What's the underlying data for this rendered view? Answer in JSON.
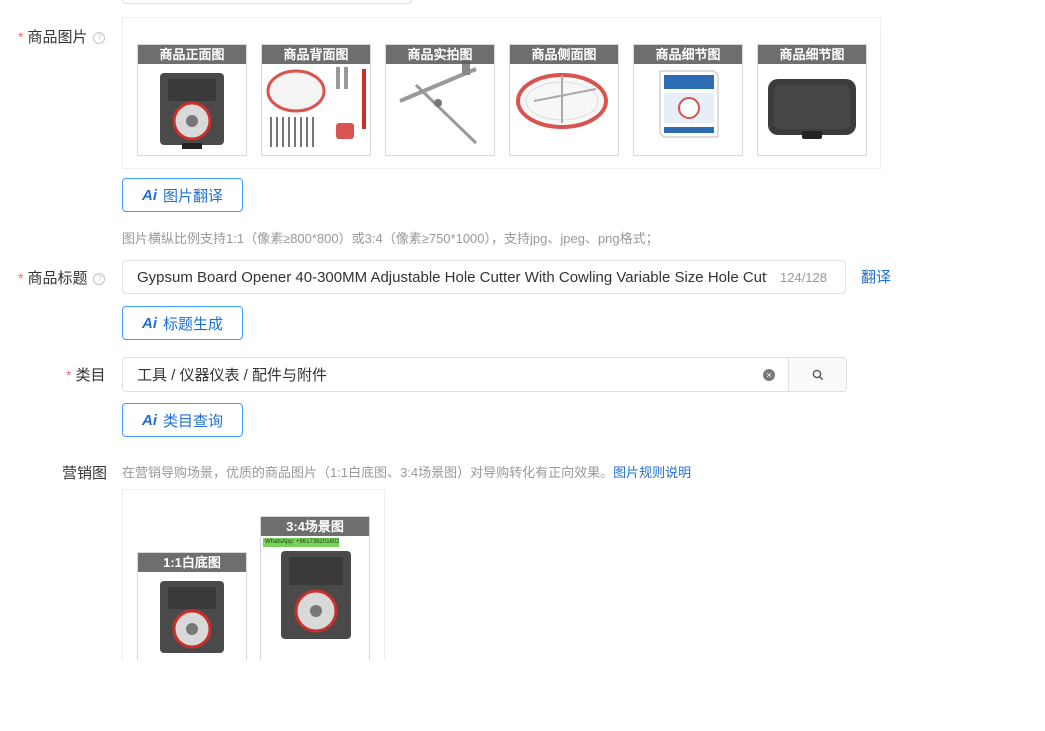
{
  "product_images": {
    "label": "商品图片",
    "help": "?",
    "thumbs": [
      {
        "caption": "商品正面图"
      },
      {
        "caption": "商品背面图"
      },
      {
        "caption": "商品实拍图"
      },
      {
        "caption": "商品侧面图"
      },
      {
        "caption": "商品细节图"
      },
      {
        "caption": "商品细节图"
      }
    ],
    "translate_button": "图片翻译",
    "hint": "图片横纵比例支持1:1（像素≥800*800）或3:4（像素≥750*1000），支持jpg、jpeg、png格式；"
  },
  "product_title": {
    "label": "商品标题",
    "help": "?",
    "value": "Gypsum Board Opener 40-300MM Adjustable Hole Cutter With Cowling Variable Size Hole Cutter",
    "count": "124/128",
    "translate_link": "翻译",
    "generate_button": "标题生成"
  },
  "category": {
    "label": "类目",
    "value": "工具 / 仪器仪表 / 配件与附件",
    "query_button": "类目查询"
  },
  "marketing": {
    "label": "营销图",
    "hint": "在营销导购场景，优质的商品图片（1:1白底图、3:4场景图）对导购转化有正向效果。",
    "rule_link": "图片规则说明",
    "thumbs": [
      {
        "caption": "1:1白底图"
      },
      {
        "caption": "3:4场景图"
      }
    ],
    "whatsapp_text": "WhatsApp: +8617362018025"
  },
  "common": {
    "required_mark": "*",
    "ai_mark": "Ai"
  },
  "colors": {
    "accent": "#1f6fd6",
    "required": "#f56c6c",
    "caption_bg": "#5a5a5a"
  }
}
